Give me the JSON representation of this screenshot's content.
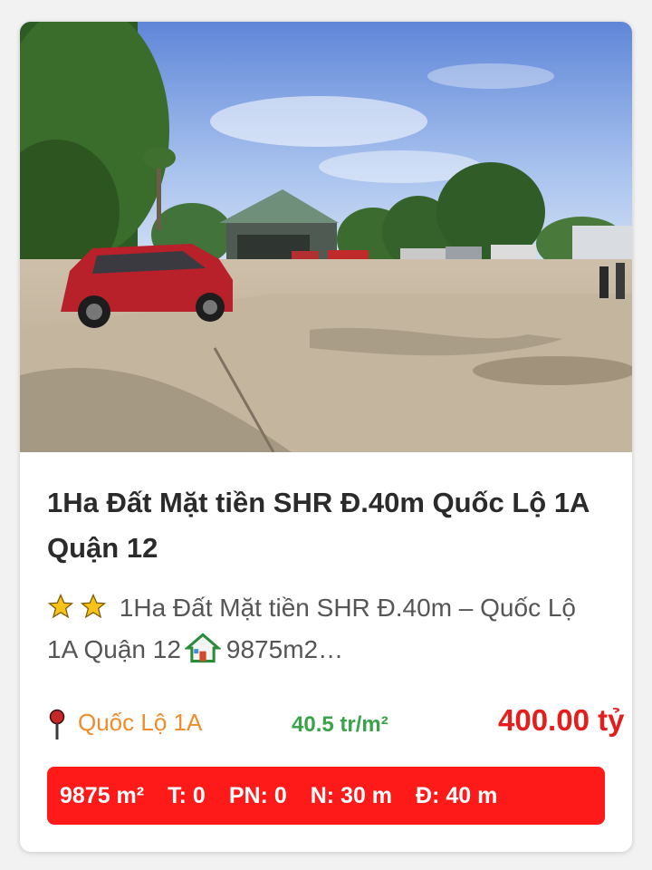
{
  "listing": {
    "title": "1Ha Đất Mặt tiền SHR Đ.40m Quốc Lộ 1A Quận 12",
    "excerpt": "1Ha Đất Mặt tiền SHR Đ.40m – Quốc Lộ 1A Quận 12",
    "excerpt_tail": "9875m2…",
    "location": "Quốc Lộ 1A",
    "price_per_m2": "40.5 tr/m²",
    "price": "400.00 tỷ",
    "specs": {
      "area": "9875 m²",
      "floors": "T: 0",
      "bedrooms": "PN: 0",
      "width": "N: 30 m",
      "road": "Đ: 40 m"
    }
  },
  "icons": {
    "rating": [
      "star-icon",
      "star-icon"
    ],
    "house": "house-icon",
    "location": "pin-icon"
  },
  "colors": {
    "title": "#2b2b2b",
    "location": "#f28c28",
    "price_per_m2": "#3aa34a",
    "price": "#e51d1d",
    "specs_bg": "#ff1a1a"
  }
}
